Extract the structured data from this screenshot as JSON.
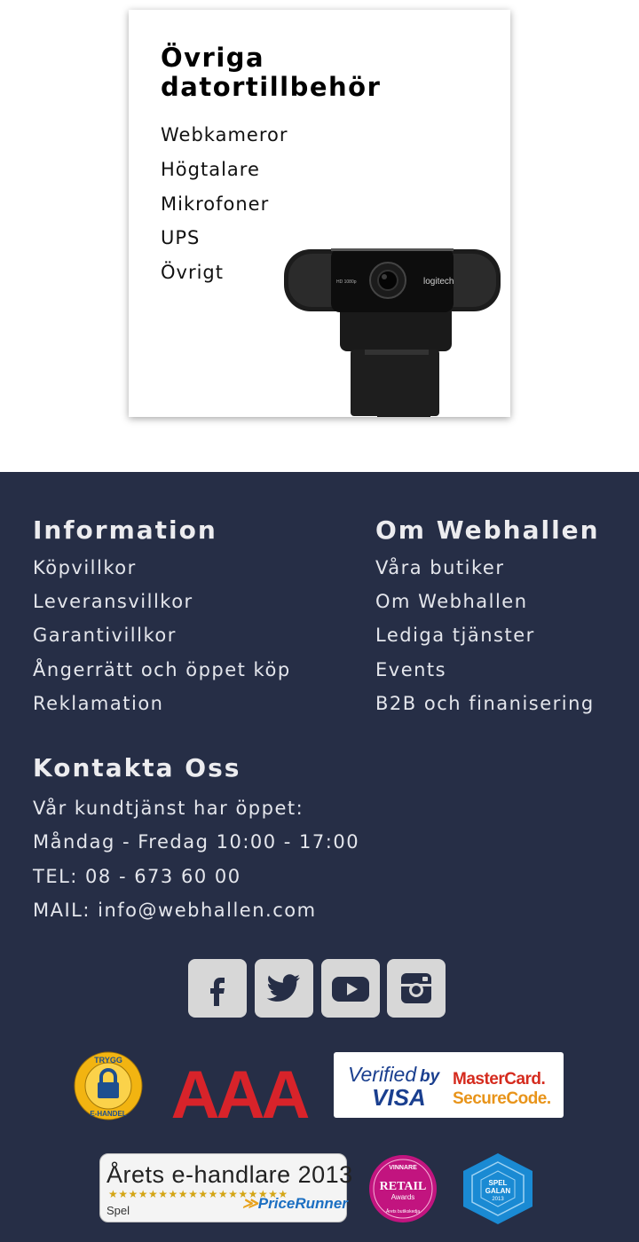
{
  "category_card": {
    "title": "Övriga datortillbehör",
    "links": [
      "Webkameror",
      "Högtalare",
      "Mikrofoner",
      "UPS",
      "Övrigt"
    ],
    "image_icon": "webcam-image",
    "webcam_brand": "logitech",
    "webcam_label": "HD 1080p"
  },
  "footer": {
    "background_color": "#262e46",
    "information": {
      "heading": "Information",
      "links": [
        "Köpvillkor",
        "Leveransvillkor",
        "Garantivillkor",
        "Ångerrätt och öppet köp",
        "Reklamation"
      ]
    },
    "about": {
      "heading": "Om Webhallen",
      "links": [
        "Våra butiker",
        "Om Webhallen",
        "Lediga tjänster",
        "Events",
        "B2B och finanisering"
      ]
    },
    "contact": {
      "heading": "Kontakta Oss",
      "lines": [
        "Vår kundtjänst har öppet:",
        "Måndag - Fredag 10:00 - 17:00",
        "TEL: 08 - 673 60 00",
        "MAIL: info@webhallen.com"
      ]
    },
    "social_icons": [
      "facebook-icon",
      "twitter-icon",
      "youtube-icon",
      "instagram-icon"
    ],
    "badges": {
      "trygg": {
        "top": "TRYGG",
        "bottom": "E-HANDEL"
      },
      "aaa": {
        "text": "AAA",
        "color": "#d8232a"
      },
      "verified": {
        "verified": "Verified",
        "by": "by",
        "visa": "VISA",
        "mastercard": "MasterCard.",
        "securecode": "SecureCode."
      },
      "pricerunner": {
        "title": "Årets e-handlare 2013",
        "stars": "★★★★★★★★★★★★★★★★★★",
        "category": "Spel",
        "brand": "PriceRunner"
      },
      "retail": {
        "top": "VINNARE",
        "middle": "RETAIL",
        "small": "Awards",
        "bottom": "Årets butikskedja"
      },
      "spelgalan": {
        "top": "SPEL",
        "middle": "GALAN",
        "year": "2013"
      }
    }
  }
}
